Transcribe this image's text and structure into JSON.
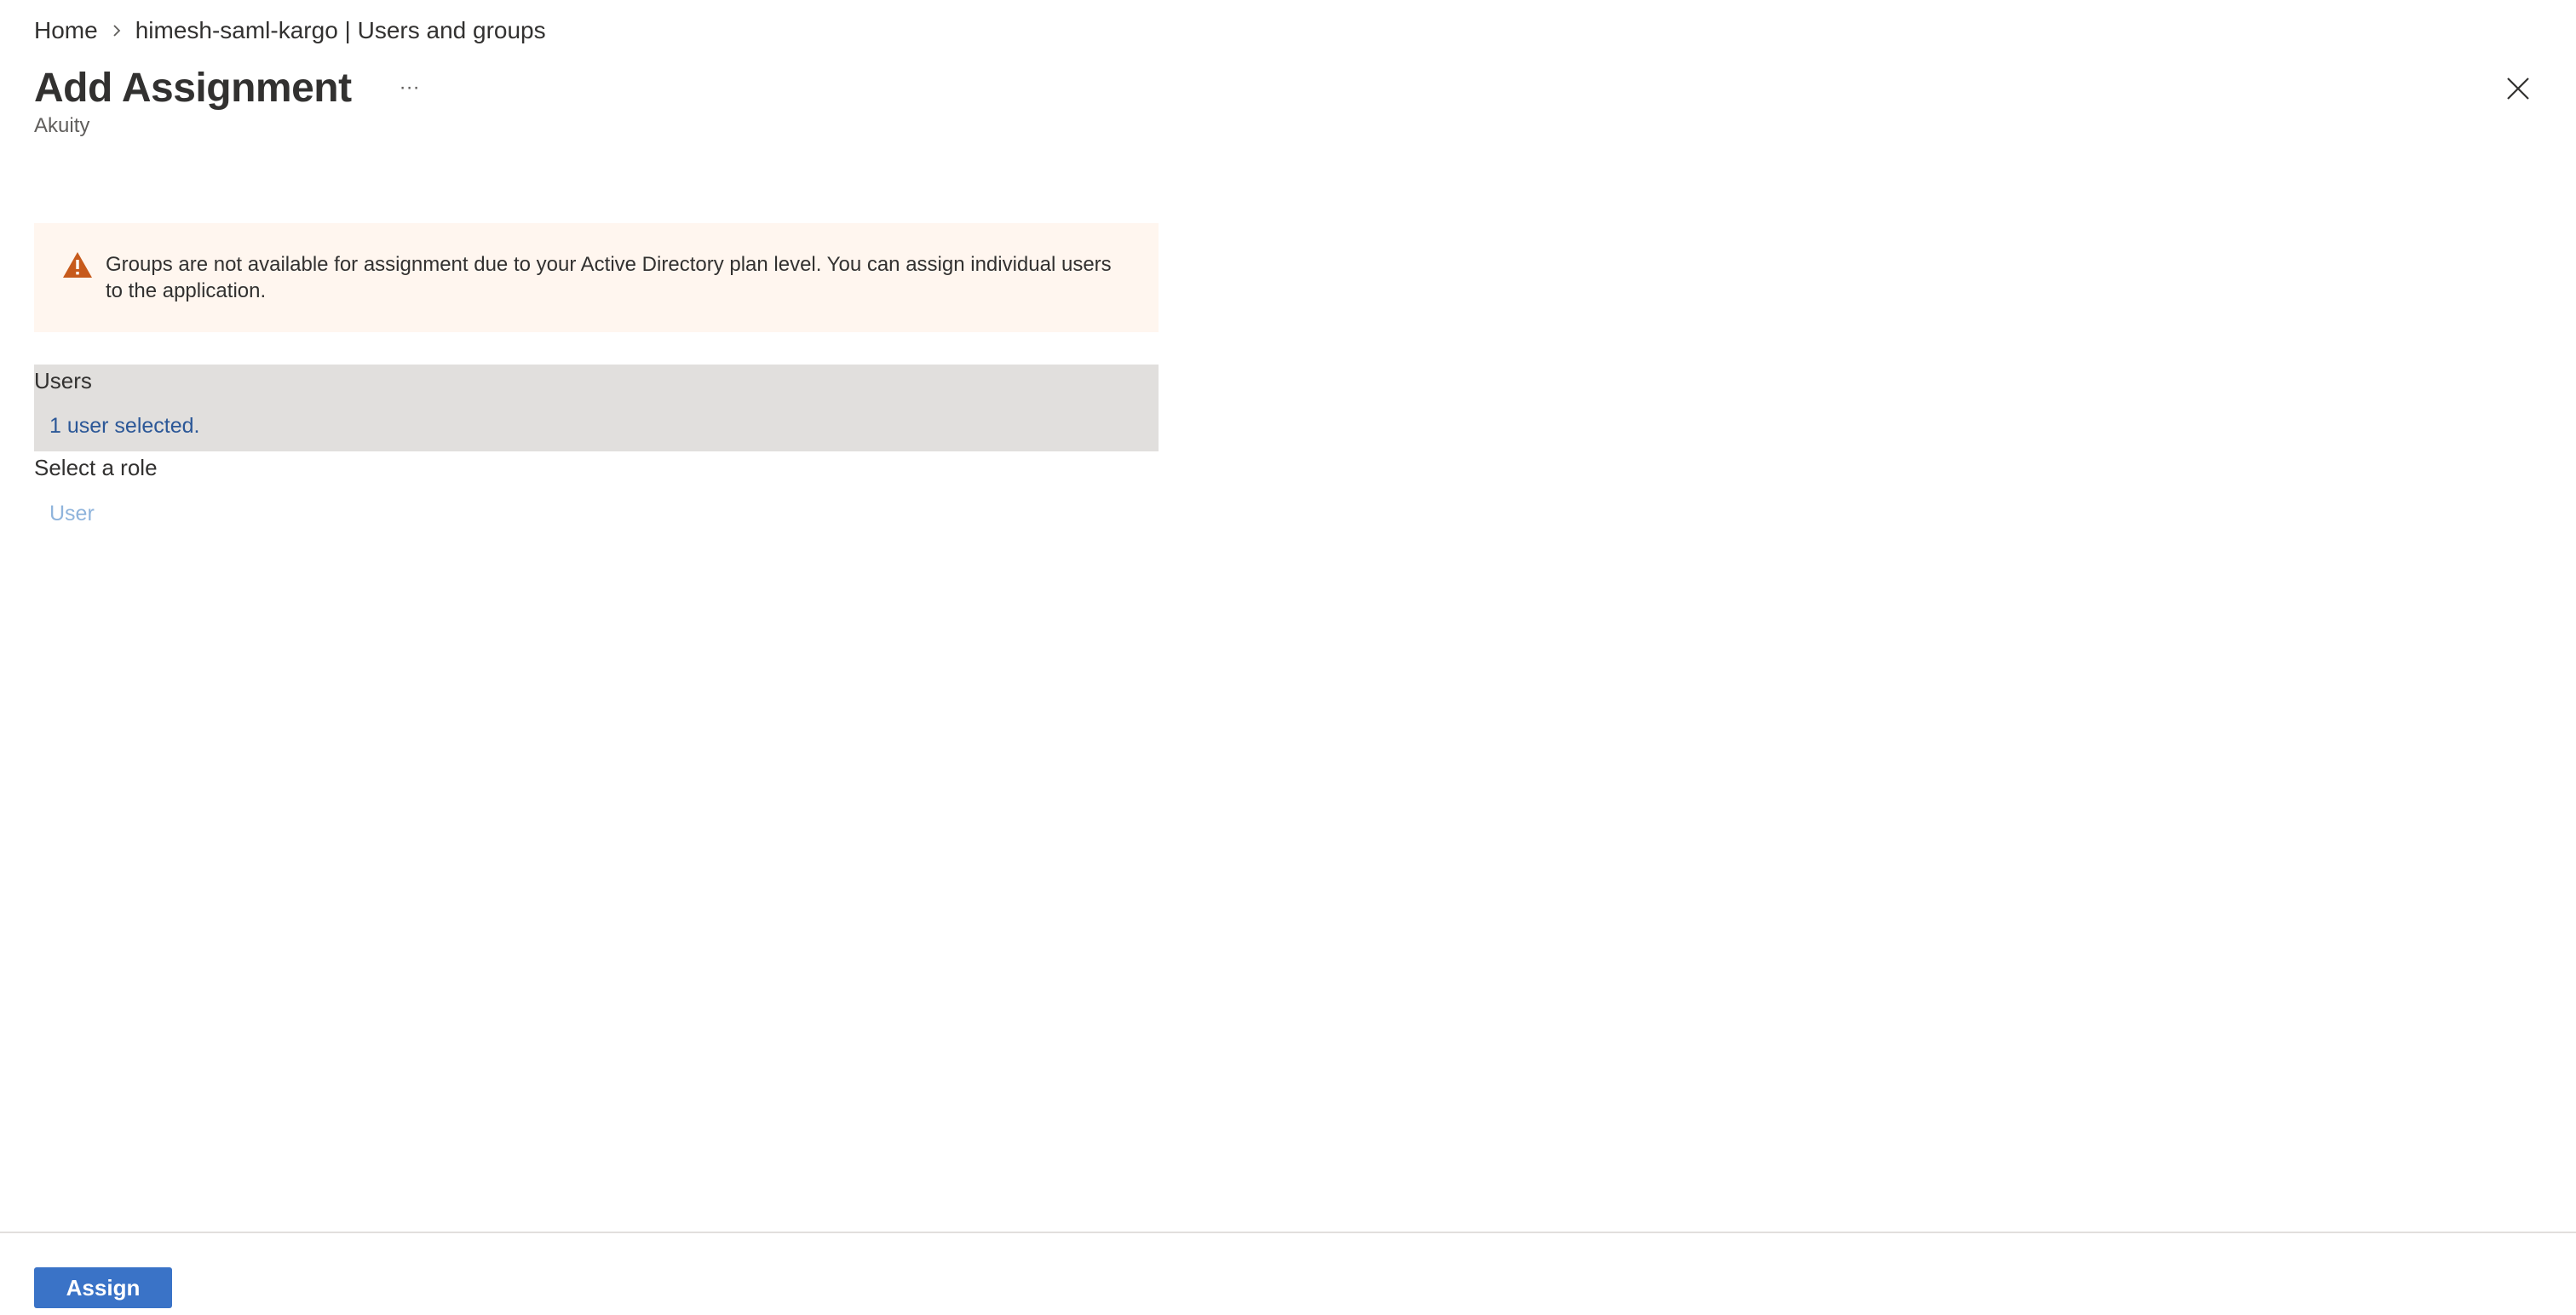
{
  "breadcrumb": {
    "home": "Home",
    "separator_icon": "chevron-right-icon",
    "current": "himesh-saml-kargo | Users and groups"
  },
  "header": {
    "title": "Add Assignment",
    "more_label": "···",
    "subtitle": "Akuity",
    "close_icon": "close-icon"
  },
  "warning": {
    "icon": "warning-icon",
    "message": "Groups are not available for assignment due to your Active Directory plan level. You can assign individual users to the application.",
    "background": "#fff6ef",
    "icon_color": "#c75a1c"
  },
  "users": {
    "label": "Users",
    "selection": "1 user selected."
  },
  "role": {
    "label": "Select a role",
    "value": "User"
  },
  "footer": {
    "assign_label": "Assign"
  },
  "colors": {
    "accent": "#3a73c7",
    "link": "#2b5797",
    "disabled_link": "#8fb4dc",
    "section_bg": "#e1dfdd"
  }
}
